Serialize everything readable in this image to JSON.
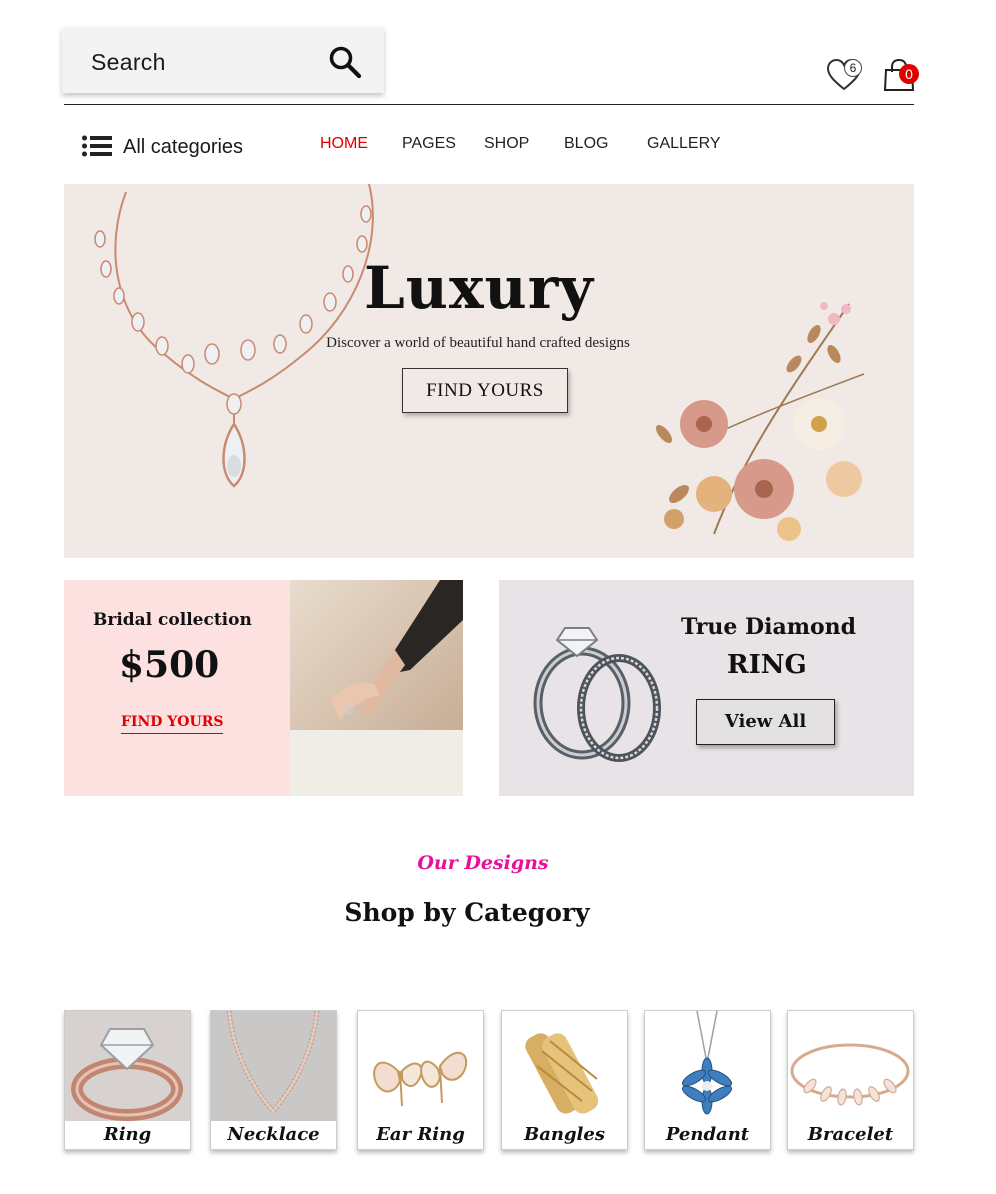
{
  "header": {
    "search_label": "Search",
    "wishlist_count": "6",
    "cart_count": "0"
  },
  "nav": {
    "categories_label": "All categories",
    "items": [
      {
        "label": "HOME",
        "active": true
      },
      {
        "label": "PAGES",
        "active": false
      },
      {
        "label": "SHOP",
        "active": false
      },
      {
        "label": "BLOG",
        "active": false
      },
      {
        "label": "GALLERY",
        "active": false
      }
    ]
  },
  "hero": {
    "title": "Luxury",
    "subtitle": "Discover a world of beautiful hand crafted designs",
    "cta": "FIND YOURS"
  },
  "bridal": {
    "title": "Bridal collection",
    "price": "$500",
    "cta": "FIND YOURS"
  },
  "diamond": {
    "title": "True Diamond",
    "subtitle": "RING",
    "cta": "View All"
  },
  "designs": {
    "eyebrow": "Our Designs",
    "title": "Shop by Category",
    "categories": [
      {
        "name": "Ring"
      },
      {
        "name": "Necklace"
      },
      {
        "name": "Ear Ring"
      },
      {
        "name": "Bangles"
      },
      {
        "name": "Pendant"
      },
      {
        "name": "Bracelet"
      }
    ]
  },
  "colors": {
    "accent_red": "#e00000",
    "accent_pink": "#e8109a",
    "hero_bg": "#f1e9e5",
    "bridal_bg": "#fde0e0",
    "diamond_bg": "#e7e3e6"
  }
}
